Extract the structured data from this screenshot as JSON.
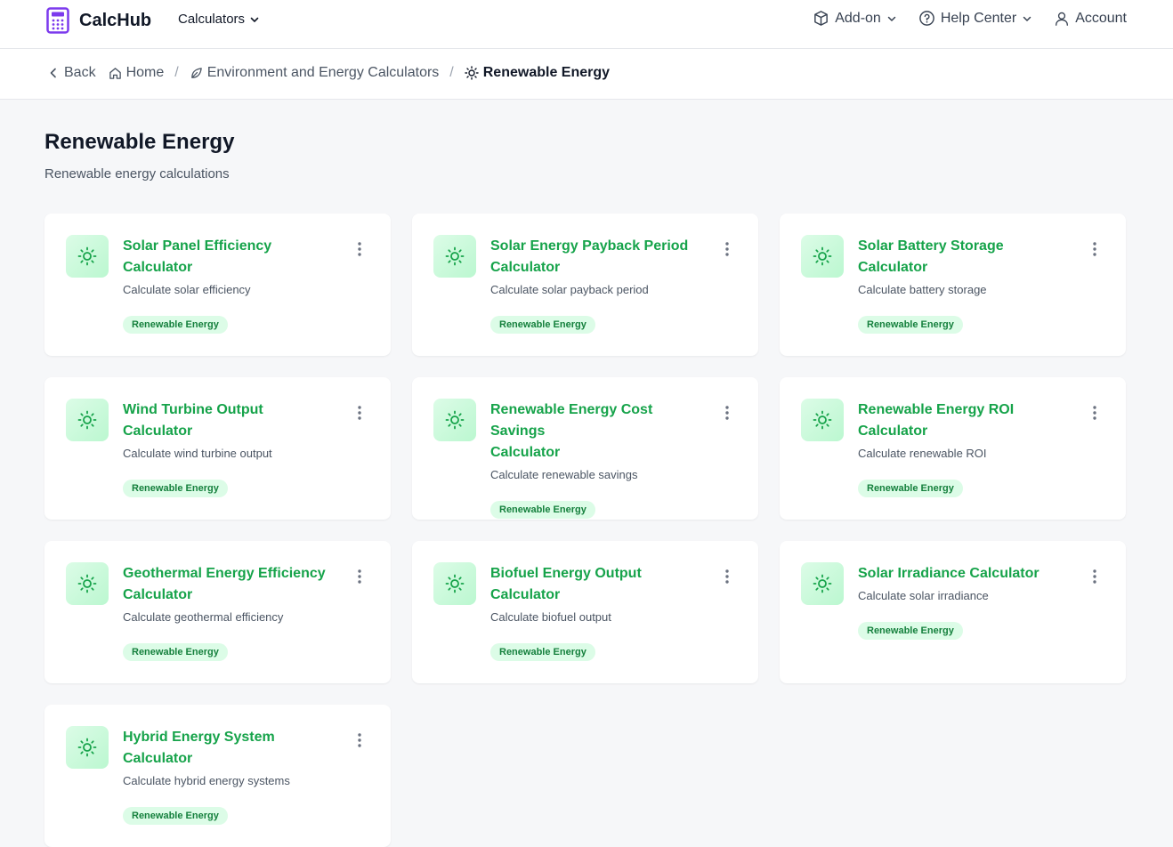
{
  "header": {
    "brand": "CalcHub",
    "calculators_label": "Calculators",
    "addon_label": "Add-on",
    "help_label": "Help Center",
    "account_label": "Account"
  },
  "breadcrumb": {
    "back": "Back",
    "home": "Home",
    "category": "Environment and Energy Calculators",
    "current": "Renewable Energy"
  },
  "page": {
    "title": "Renewable Energy",
    "subtitle": "Renewable energy calculations"
  },
  "colors": {
    "accent": "#16a34a",
    "tag_bg": "#dcfce7",
    "brand_icon": "#7c3aed"
  },
  "cards": [
    {
      "title_line1": "Solar Panel Efficiency",
      "title_line2": "Calculator",
      "desc": "Calculate solar efficiency",
      "tag": "Renewable Energy",
      "icon": "sun-icon"
    },
    {
      "title_line1": "Solar Energy Payback Period",
      "title_line2": "Calculator",
      "desc": "Calculate solar payback period",
      "tag": "Renewable Energy",
      "icon": "sun-icon"
    },
    {
      "title_line1": "Solar Battery Storage",
      "title_line2": "Calculator",
      "desc": "Calculate battery storage",
      "tag": "Renewable Energy",
      "icon": "sun-icon"
    },
    {
      "title_line1": "Wind Turbine Output",
      "title_line2": "Calculator",
      "desc": "Calculate wind turbine output",
      "tag": "Renewable Energy",
      "icon": "sun-icon"
    },
    {
      "title_line1": "Renewable Energy Cost Savings",
      "title_line2": "Calculator",
      "desc": "Calculate renewable savings",
      "tag": "Renewable Energy",
      "icon": "sun-icon"
    },
    {
      "title_line1": "Renewable Energy ROI",
      "title_line2": "Calculator",
      "desc": "Calculate renewable ROI",
      "tag": "Renewable Energy",
      "icon": "sun-icon"
    },
    {
      "title_line1": "Geothermal Energy Efficiency",
      "title_line2": "Calculator",
      "desc": "Calculate geothermal efficiency",
      "tag": "Renewable Energy",
      "icon": "sun-icon"
    },
    {
      "title_line1": "Biofuel Energy Output",
      "title_line2": "Calculator",
      "desc": "Calculate biofuel output",
      "tag": "Renewable Energy",
      "icon": "sun-icon"
    },
    {
      "title_line1": "Solar Irradiance Calculator",
      "title_line2": "",
      "desc": "Calculate solar irradiance",
      "tag": "Renewable Energy",
      "icon": "sun-icon"
    },
    {
      "title_line1": "Hybrid Energy System",
      "title_line2": "Calculator",
      "desc": "Calculate hybrid energy systems",
      "tag": "Renewable Energy",
      "icon": "sun-icon"
    }
  ]
}
